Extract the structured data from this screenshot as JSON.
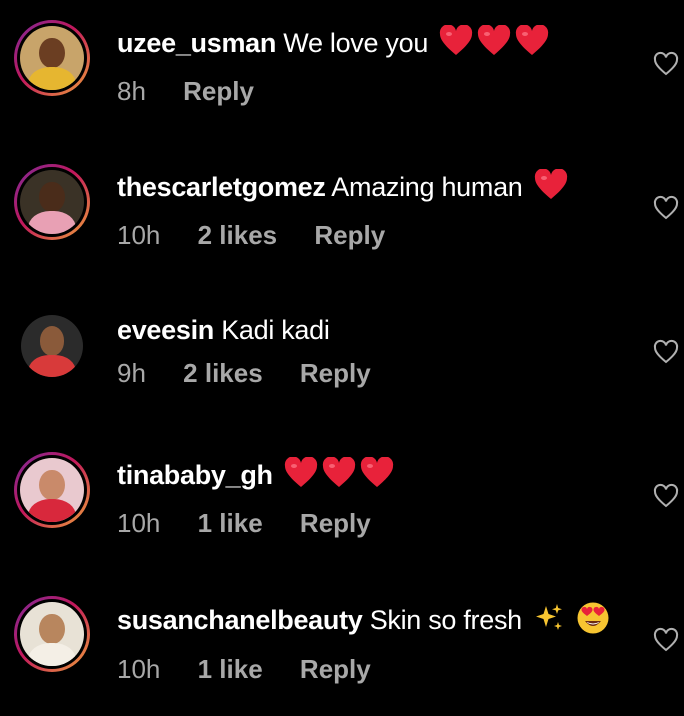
{
  "colors": {
    "background": "#000000",
    "username": "#ffffff",
    "meta": "#a8a8a8",
    "heart_emoji": "#e8223a",
    "story_ring_start": "#7a2a9c",
    "story_ring_end": "#f0a33a"
  },
  "comments": [
    {
      "username": "uzee_usman",
      "text": "We love you",
      "emojis": [
        "red-heart",
        "red-heart",
        "red-heart"
      ],
      "time": "8h",
      "likes": "",
      "reply": "Reply",
      "avatar_ring": "story",
      "like_icon": "heart-outline-icon"
    },
    {
      "username": "thescarletgomez",
      "text": "Amazing human",
      "emojis": [
        "red-heart"
      ],
      "time": "10h",
      "likes": "2 likes",
      "reply": "Reply",
      "avatar_ring": "story",
      "like_icon": "heart-outline-icon"
    },
    {
      "username": "eveesin",
      "text": "Kadi kadi",
      "emojis": [],
      "time": "9h",
      "likes": "2 likes",
      "reply": "Reply",
      "avatar_ring": "none",
      "like_icon": "heart-outline-icon"
    },
    {
      "username": "tinababy_gh",
      "text": "",
      "emojis": [
        "red-heart",
        "red-heart",
        "red-heart"
      ],
      "time": "10h",
      "likes": "1 like",
      "reply": "Reply",
      "avatar_ring": "story",
      "like_icon": "heart-outline-icon"
    },
    {
      "username": "susanchanelbeauty",
      "text": "Skin so fresh",
      "emojis": [
        "sparkles",
        "heart-eyes"
      ],
      "time": "10h",
      "likes": "1 like",
      "reply": "Reply",
      "avatar_ring": "story",
      "like_icon": "heart-outline-icon"
    }
  ]
}
